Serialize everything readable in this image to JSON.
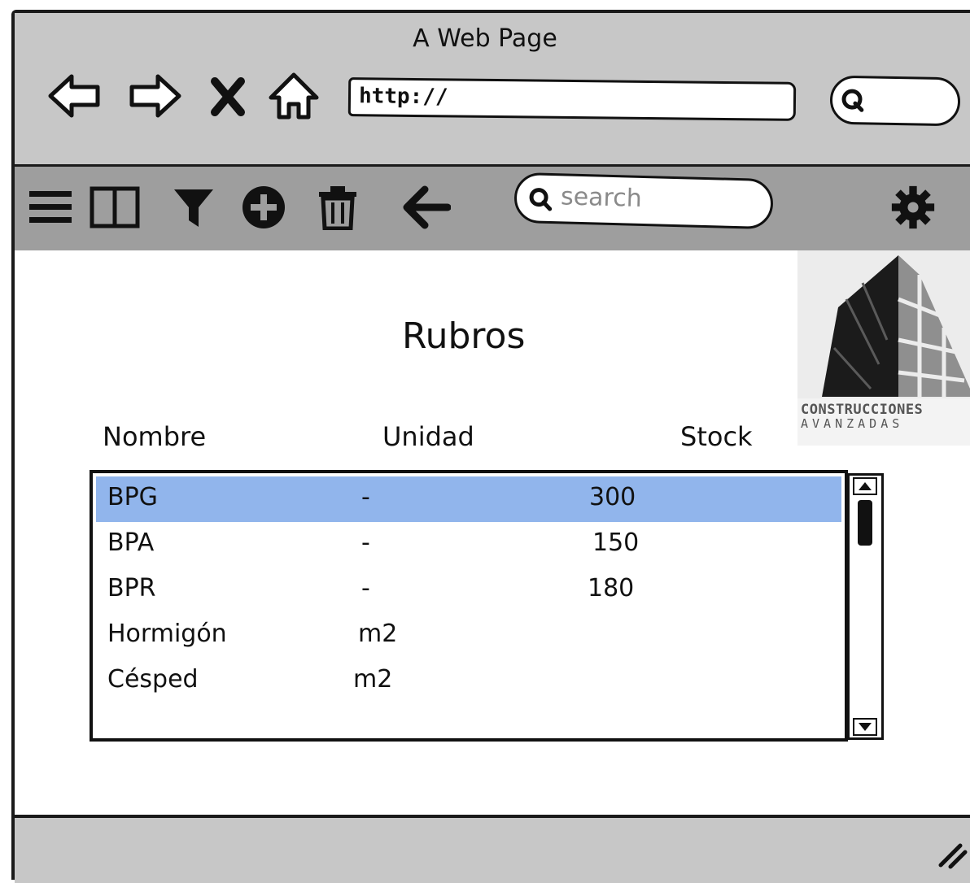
{
  "window": {
    "title": "A Web Page"
  },
  "browser": {
    "url": "http://",
    "nav_icons": [
      "back-arrow-icon",
      "forward-arrow-icon",
      "stop-x-icon",
      "home-icon"
    ]
  },
  "toolbar": {
    "icons": [
      "hamburger-menu-icon",
      "split-pane-icon",
      "filter-icon",
      "add-circle-icon",
      "trash-icon",
      "arrow-left-icon",
      "gear-icon"
    ],
    "search_placeholder": "search"
  },
  "logo": {
    "line1": "CONSTRUCCIONES",
    "line2": "AVANZADAS"
  },
  "page": {
    "title": "Rubros"
  },
  "table": {
    "headers": [
      "Nombre",
      "Unidad",
      "Stock"
    ],
    "rows": [
      {
        "nombre": "BPG",
        "unidad": "-",
        "stock": "300"
      },
      {
        "nombre": "BPA",
        "unidad": "-",
        "stock": "150"
      },
      {
        "nombre": "BPR",
        "unidad": "-",
        "stock": "180"
      },
      {
        "nombre": "Hormigón",
        "unidad": "m2",
        "stock": ""
      },
      {
        "nombre": "Césped",
        "unidad": "m2",
        "stock": ""
      }
    ],
    "selected_row": 0
  },
  "colors": {
    "selection": "#91b5ec",
    "titlebar": "#c7c7c7",
    "toolbar": "#9e9e9e"
  }
}
